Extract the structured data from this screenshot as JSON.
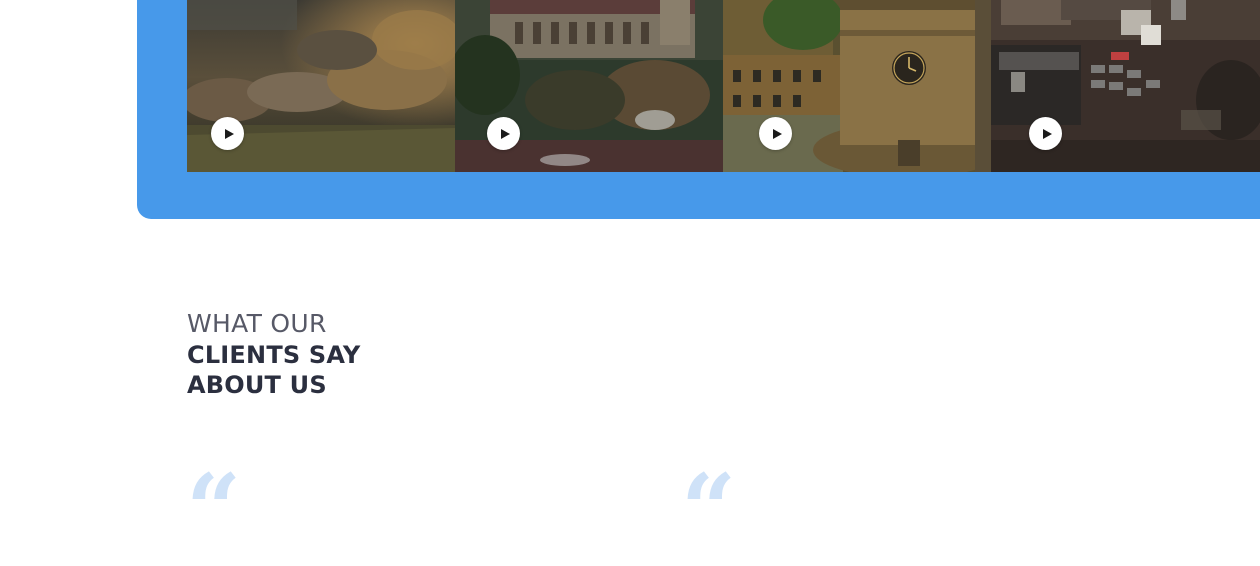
{
  "videos": [
    {
      "id": "video-1",
      "scene": "aerial-fields-trees",
      "play_label": "play"
    },
    {
      "id": "video-2",
      "scene": "abbey-church-aerial",
      "play_label": "play"
    },
    {
      "id": "video-3",
      "scene": "clock-tower-aerial",
      "play_label": "play"
    },
    {
      "id": "video-4",
      "scene": "rooftops-car-park-aerial",
      "play_label": "play"
    }
  ],
  "testimonials": {
    "heading_line1": "WHAT OUR",
    "heading_line2": "CLIENTS SAY",
    "heading_line3": "ABOUT US",
    "quote_mark": "“"
  },
  "colors": {
    "accent_blue": "#4799ea",
    "heading_dark": "#2b2f3f",
    "quote_light_blue": "#cfe2f8"
  }
}
